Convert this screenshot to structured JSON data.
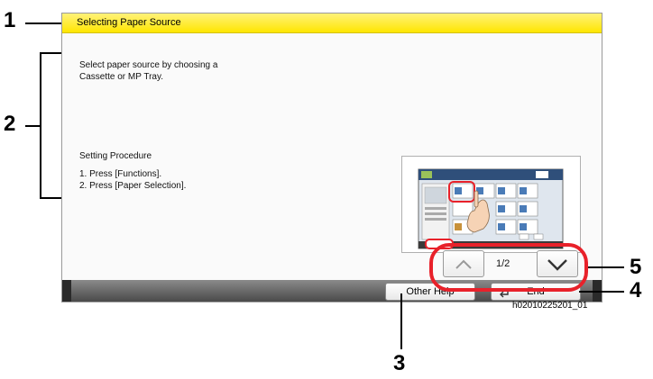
{
  "callouts": {
    "one": "1",
    "two": "2",
    "three": "3",
    "four": "4",
    "five": "5"
  },
  "help": {
    "title": "Selecting Paper Source",
    "description_line1": "Select paper source by choosing a",
    "description_line2": "Cassette or MP Tray.",
    "procedure_heading": "Setting Procedure",
    "step1": "1. Press [Functions].",
    "step2": "2. Press [Paper Selection]."
  },
  "pager": {
    "page_indicator": "1/2"
  },
  "buttons": {
    "other_help": "Other Help",
    "end": "End"
  },
  "figure_id": "h02010225201_01",
  "colors": {
    "title_bar": "#ffe600",
    "callout_red": "#e8212a"
  }
}
